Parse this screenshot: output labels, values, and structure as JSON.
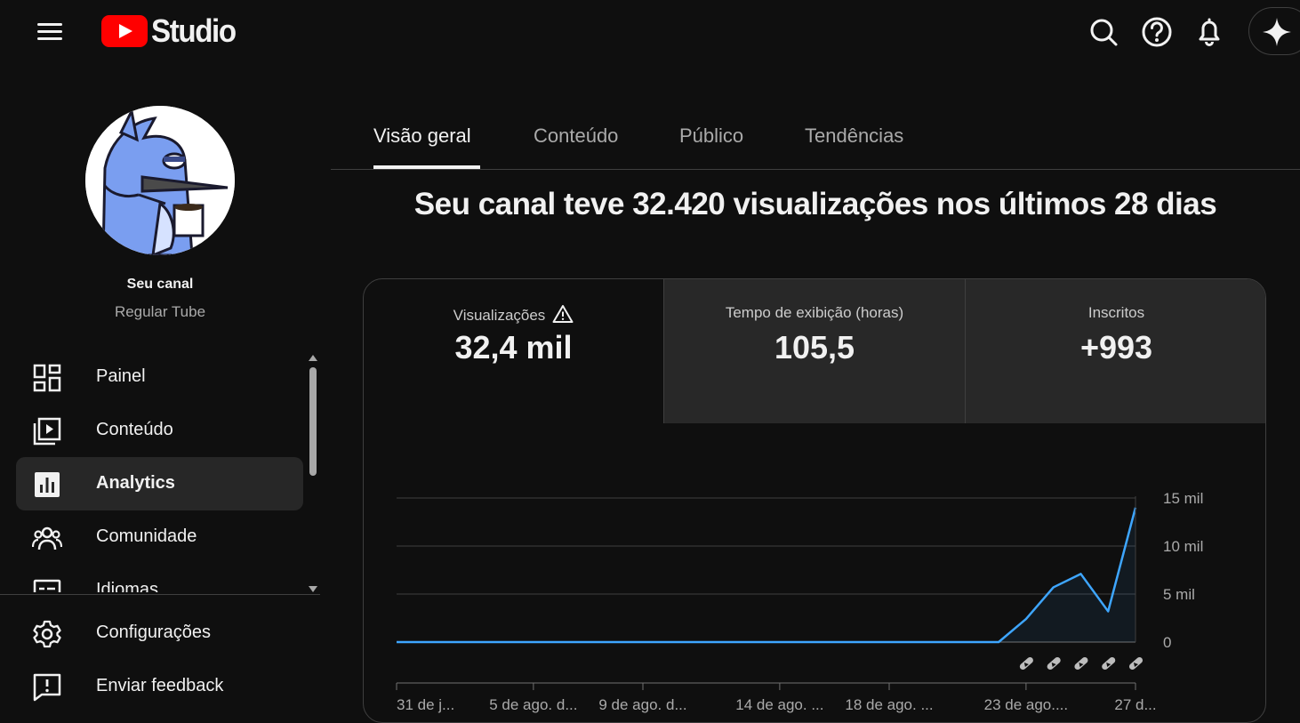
{
  "app": {
    "logo_text": "Studio"
  },
  "header": {
    "icons": [
      "search-icon",
      "help-icon",
      "bell-icon",
      "sparkle-icon"
    ]
  },
  "channel": {
    "name": "Seu canal",
    "handle": "Regular Tube"
  },
  "sidebar": {
    "items": [
      {
        "label": "Painel",
        "icon": "dashboard-icon",
        "active": false
      },
      {
        "label": "Conteúdo",
        "icon": "content-icon",
        "active": false
      },
      {
        "label": "Analytics",
        "icon": "analytics-icon",
        "active": true
      },
      {
        "label": "Comunidade",
        "icon": "community-icon",
        "active": false
      },
      {
        "label": "Idiomas",
        "icon": "subtitles-icon",
        "active": false
      }
    ],
    "bottom": [
      {
        "label": "Configurações",
        "icon": "gear-icon"
      },
      {
        "label": "Enviar feedback",
        "icon": "feedback-icon"
      }
    ]
  },
  "tabs": [
    {
      "label": "Visão geral",
      "active": true
    },
    {
      "label": "Conteúdo",
      "active": false
    },
    {
      "label": "Público",
      "active": false
    },
    {
      "label": "Tendências",
      "active": false
    }
  ],
  "headline": "Seu canal teve 32.420 visualizações nos últimos 28 dias",
  "metrics": [
    {
      "label": "Visualizações",
      "value": "32,4 mil",
      "warning": true,
      "active": true
    },
    {
      "label": "Tempo de exibição (horas)",
      "value": "105,5",
      "warning": false,
      "active": false
    },
    {
      "label": "Inscritos",
      "value": "+993",
      "warning": false,
      "active": false
    }
  ],
  "colors": {
    "accent_line": "#3ea6ff",
    "brand_red": "#ff0000",
    "active_nav_bg": "#272727"
  },
  "chart_data": {
    "type": "line",
    "y_tick_labels": [
      "0",
      "5 mil",
      "10 mil",
      "15 mil"
    ],
    "y_ticks": [
      0,
      5000,
      10000,
      15000
    ],
    "ylim": [
      0,
      15000
    ],
    "x_tick_labels": [
      "31 de j...",
      "5 de ago. d...",
      "9 de ago. d...",
      "14 de ago. ...",
      "18 de ago. ...",
      "23 de ago....",
      "27 d..."
    ],
    "x_tick_days": [
      0,
      5,
      9,
      14,
      18,
      23,
      27
    ],
    "series": [
      {
        "values": [
          0,
          0,
          0,
          0,
          0,
          0,
          0,
          0,
          0,
          0,
          0,
          0,
          0,
          0,
          0,
          0,
          0,
          0,
          0,
          0,
          0,
          0,
          0,
          2400,
          5700,
          7100,
          3200,
          14000
        ]
      }
    ],
    "shorts_marker_days": [
      23,
      24,
      25,
      26,
      27
    ],
    "grid": true
  }
}
